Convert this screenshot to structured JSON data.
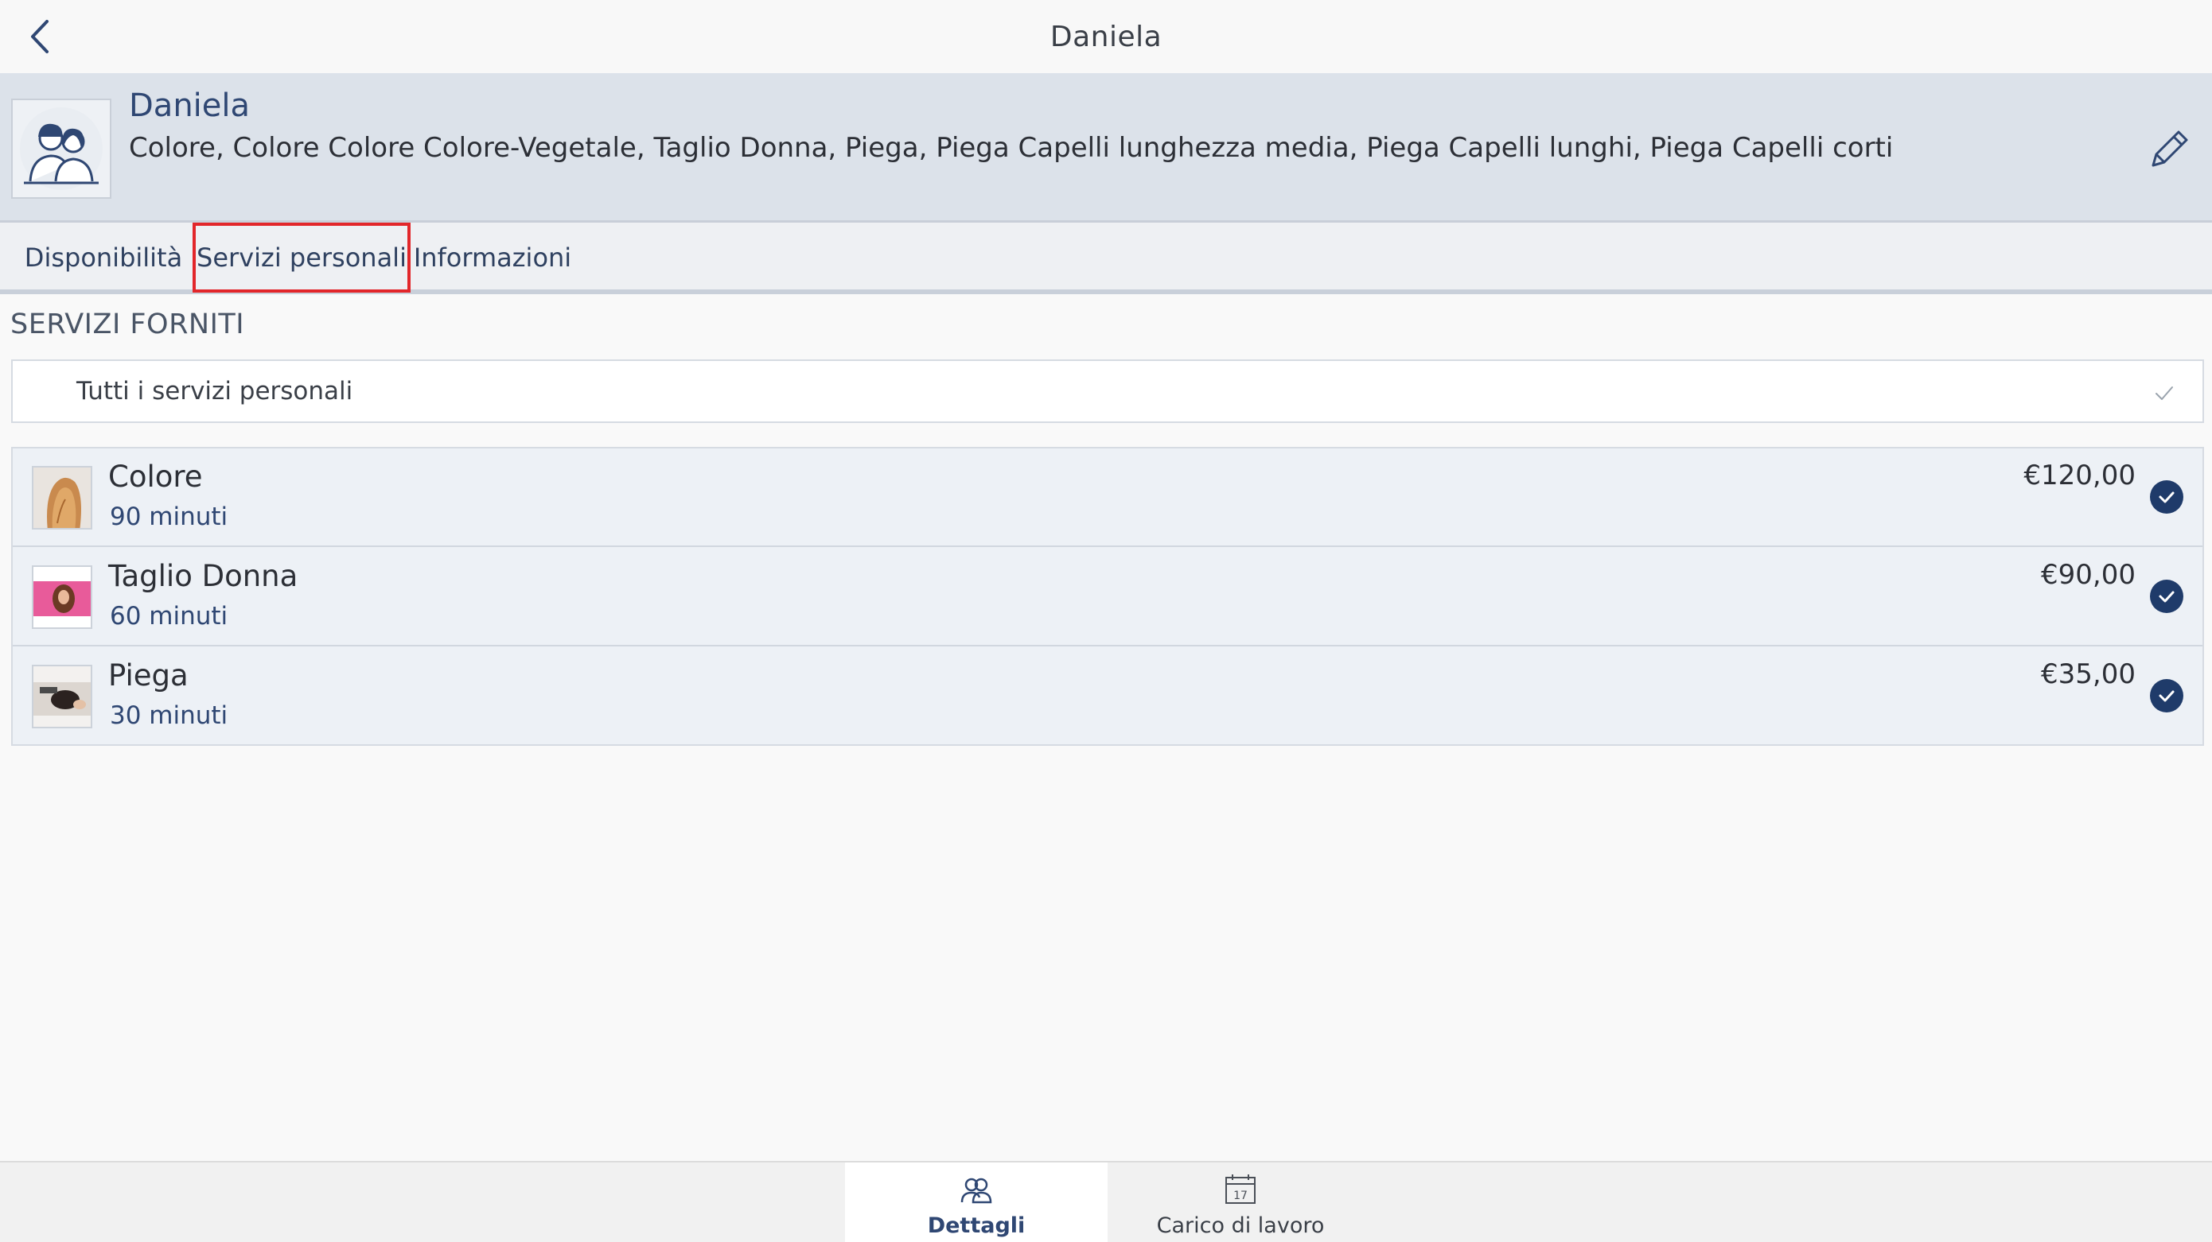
{
  "topbar": {
    "title": "Daniela",
    "back_icon": "chevron-left-icon"
  },
  "profile": {
    "name": "Daniela",
    "services_summary": "Colore, Colore Colore Colore-Vegetale, Taglio Donna, Piega, Piega Capelli lunghezza media, Piega Capelli lunghi, Piega Capelli corti",
    "avatar_icon": "staff-avatar-icon",
    "edit_icon": "pencil-icon"
  },
  "tabs": [
    {
      "label": "Disponibilità",
      "active": false
    },
    {
      "label": "Servizi personali",
      "active": true
    },
    {
      "label": "Informazioni",
      "active": false
    }
  ],
  "section": {
    "title": "SERVIZI FORNITI",
    "all_services_label": "Tutti i servizi personali"
  },
  "services": [
    {
      "name": "Colore",
      "duration": "90 minuti",
      "price": "€120,00",
      "selected": true,
      "thumb": "hair-color-photo"
    },
    {
      "name": "Taglio Donna",
      "duration": "60 minuti",
      "price": "€90,00",
      "selected": true,
      "thumb": "woman-haircut-photo"
    },
    {
      "name": "Piega",
      "duration": "30 minuti",
      "price": "€35,00",
      "selected": true,
      "thumb": "blow-dry-photo"
    }
  ],
  "bottom_nav": [
    {
      "label": "Dettagli",
      "icon": "people-icon",
      "active": true
    },
    {
      "label": "Carico di lavoro",
      "icon": "calendar-icon",
      "active": false,
      "icon_text": "17"
    }
  ],
  "colors": {
    "accent": "#2f4773",
    "check": "#1f3b6a",
    "highlight_border": "#e2262a",
    "header_bg": "#dce2ea"
  }
}
